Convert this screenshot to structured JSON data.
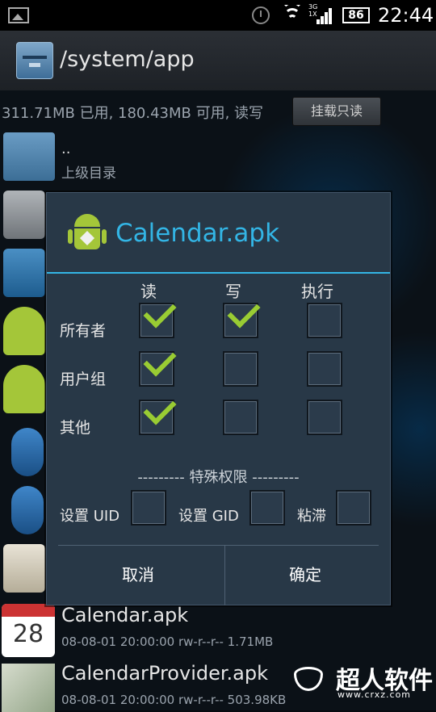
{
  "status_bar": {
    "network_label": "3G\n1X",
    "battery": "86",
    "time": "22:44"
  },
  "title_bar": {
    "path": "/system/app"
  },
  "storage": {
    "info": "311.71MB 已用, 180.43MB 可用, 读写",
    "mount_button": "挂载只读"
  },
  "list": {
    "parent_dots": "..",
    "parent_label": "上级目录",
    "files": [
      {
        "name": "Calendar.apk",
        "meta": "08-08-01 20:00:00  rw-r--r--  1.71MB",
        "icon_day": "28"
      },
      {
        "name": "CalendarProvider.apk",
        "meta": "08-08-01 20:00:00  rw-r--r--  503.98KB"
      }
    ]
  },
  "dialog": {
    "title": "Calendar.apk",
    "columns": [
      "读",
      "写",
      "执行"
    ],
    "rows": [
      {
        "label": "所有者",
        "read": true,
        "write": true,
        "exec": false
      },
      {
        "label": "用户组",
        "read": true,
        "write": false,
        "exec": false
      },
      {
        "label": "其他",
        "read": true,
        "write": false,
        "exec": false
      }
    ],
    "special_header": "--------- 特殊权限 ---------",
    "special": [
      {
        "label": "设置 UID",
        "checked": false
      },
      {
        "label": "设置 GID",
        "checked": false
      },
      {
        "label": "粘滞",
        "checked": false
      }
    ],
    "cancel": "取消",
    "ok": "确定"
  },
  "watermark": {
    "text": "超人软件",
    "url": "www.crxz.com"
  },
  "colors": {
    "accent": "#33b5e5",
    "check": "#99cc33",
    "dialog_bg": "#283847"
  }
}
